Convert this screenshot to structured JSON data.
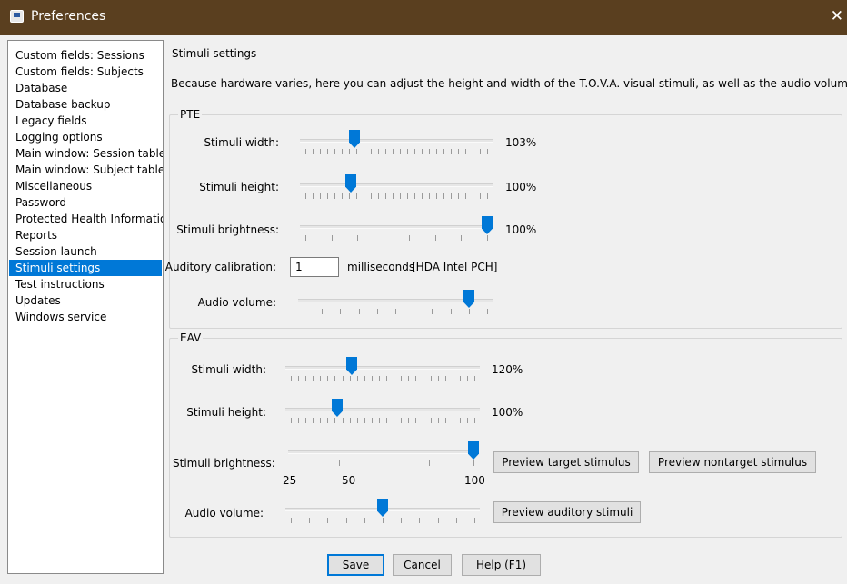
{
  "window": {
    "title": "Preferences",
    "close_glyph": "✕"
  },
  "sidebar": {
    "items": [
      {
        "label": "Custom fields: Sessions",
        "selected": false
      },
      {
        "label": "Custom fields: Subjects",
        "selected": false
      },
      {
        "label": "Database",
        "selected": false
      },
      {
        "label": "Database backup",
        "selected": false
      },
      {
        "label": "Legacy fields",
        "selected": false
      },
      {
        "label": "Logging options",
        "selected": false
      },
      {
        "label": "Main window: Session table",
        "selected": false
      },
      {
        "label": "Main window: Subject table",
        "selected": false
      },
      {
        "label": "Miscellaneous",
        "selected": false
      },
      {
        "label": "Password",
        "selected": false
      },
      {
        "label": "Protected Health Information",
        "selected": false
      },
      {
        "label": "Reports",
        "selected": false
      },
      {
        "label": "Session launch",
        "selected": false
      },
      {
        "label": "Stimuli settings",
        "selected": true
      },
      {
        "label": "Test instructions",
        "selected": false
      },
      {
        "label": "Updates",
        "selected": false
      },
      {
        "label": "Windows service",
        "selected": false
      }
    ]
  },
  "main": {
    "title": "Stimuli settings",
    "description": "Because hardware varies, here you can adjust the height and width of the T.O.V.A. visual stimuli, as well as the audio volume.",
    "pte": {
      "title": "PTE",
      "width": {
        "label": "Stimuli width:",
        "value": "103%",
        "level": 0.27
      },
      "height": {
        "label": "Stimuli height:",
        "value": "100%",
        "level": 0.25
      },
      "brightness": {
        "label": "Stimuli brightness:",
        "value": "100%",
        "level": 1.0
      },
      "auditory": {
        "label": "Auditory calibration:",
        "value": "1",
        "units": "milliseconds",
        "device": "[HDA Intel PCH]"
      },
      "volume": {
        "label": "Audio volume:",
        "level": 0.9
      }
    },
    "eav": {
      "title": "EAV",
      "width": {
        "label": "Stimuli width:",
        "value": "120%",
        "level": 0.33
      },
      "height": {
        "label": "Stimuli height:",
        "value": "100%",
        "level": 0.25
      },
      "brightness": {
        "label": "Stimuli brightness:",
        "level": 1.0,
        "tick_labels": [
          "25",
          "50",
          "100"
        ]
      },
      "volume": {
        "label": "Audio volume:",
        "level": 0.5
      },
      "preview_target_label": "Preview target stimulus",
      "preview_nontarget_label": "Preview nontarget stimulus",
      "preview_auditory_label": "Preview auditory stimuli"
    }
  },
  "footer": {
    "save_label": "Save",
    "cancel_label": "Cancel",
    "help_label": "Help (F1)"
  },
  "colors": {
    "accent": "#0078d7",
    "titlebar": "#5a3f1f"
  }
}
